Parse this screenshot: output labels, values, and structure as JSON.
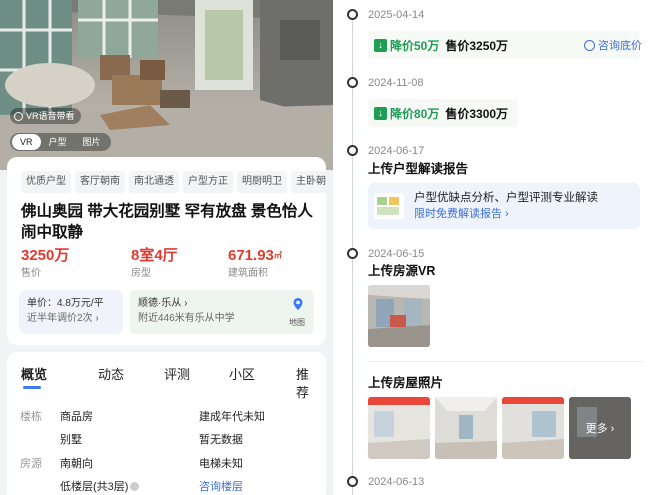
{
  "listing": {
    "vr_voice_label": "VR语音带看",
    "media_tabs": [
      "VR",
      "户型",
      "图片"
    ],
    "tags": [
      "优质户型",
      "客厅朝南",
      "南北通透",
      "户型方正",
      "明厨明卫",
      "主卧朝南"
    ],
    "title": "佛山奥园 带大花园别墅 罕有放盘 景色怡人闹中取静",
    "price": {
      "value": "3250万",
      "label": "售价"
    },
    "layout": {
      "value": "8室4厅",
      "label": "房型"
    },
    "area": {
      "value": "671.93",
      "unit": "㎡",
      "label": "建筑面积"
    },
    "unit_price": {
      "line1": "单价：4.8万元/平",
      "line2": "近半年调价2次",
      "arrow": "›"
    },
    "location": {
      "line1": "顺德·乐从",
      "arrow": "›",
      "line2": "附近446米有乐从中学",
      "map_label": "地图"
    }
  },
  "detail": {
    "tabs": [
      "概览",
      "动态",
      "评测",
      "小区",
      "推荐"
    ],
    "rows": [
      {
        "key": "楼栋",
        "left": "商品房",
        "right": "建成年代未知"
      },
      {
        "key": "",
        "left": "别墅",
        "right": "暂无数据"
      },
      {
        "key": "房源",
        "left": "南朝向",
        "right": "电梯未知"
      },
      {
        "key": "",
        "left": "低楼层(共3层)",
        "right": "咨询楼层"
      }
    ]
  },
  "timeline": {
    "events": [
      {
        "date": "2025-04-14",
        "drop": "降价50万",
        "price": "售价3250万",
        "action": "咨询底价"
      },
      {
        "date": "2024-11-08",
        "drop": "降价80万",
        "price": "售价3300万"
      },
      {
        "date": "2024-06-17",
        "title": "上传户型解读报告",
        "report_line1": "户型优缺点分析、户型评测专业解读",
        "report_line2": "限时免费解读报告 ›"
      },
      {
        "date": "2024-06-15",
        "title": "上传房源VR"
      },
      {
        "title": "上传房屋照片",
        "more": "更多 ›"
      },
      {
        "date": "2024-06-13"
      }
    ]
  },
  "colors": {
    "price_red": "#e03b2f",
    "drop_green": "#1f9d55",
    "link_blue": "#3b6fd8",
    "tab_blue": "#3b7cf5"
  }
}
